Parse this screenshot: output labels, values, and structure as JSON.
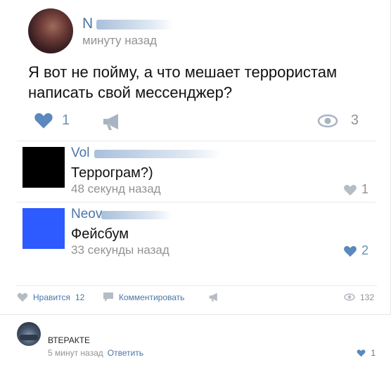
{
  "post": {
    "author_name": "N",
    "time": "минуту назад",
    "text": "Я вот не пойму, а что мешает террористам написать свой мессенджер?",
    "likes": "1",
    "views": "3"
  },
  "comments": [
    {
      "name": "Vol",
      "text": "Террограм?)",
      "time": "48 секунд назад",
      "likes": "1",
      "liked": false,
      "avatar_color": "#000000"
    },
    {
      "name": "Neov",
      "text": "Фейсбум",
      "time": "33 секунды назад",
      "likes": "2",
      "liked": true,
      "avatar_color": "#2d5bff"
    }
  ],
  "footer": {
    "like_label": "Нравится",
    "like_count": "12",
    "comment_label": "Комментировать",
    "views": "132"
  },
  "reply": {
    "name": "ВТЕРАКТЕ",
    "time": "5 минут назад",
    "reply_label": "Ответить",
    "likes": "1"
  },
  "colors": {
    "accent": "#4a76a8",
    "like_active": "#5b88bd",
    "muted": "#939393"
  },
  "icons": [
    "heart-icon",
    "megaphone-icon",
    "eye-icon",
    "comment-icon"
  ]
}
